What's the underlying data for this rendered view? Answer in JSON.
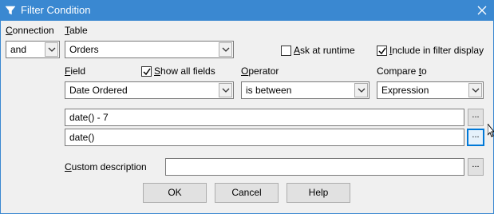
{
  "window": {
    "title": "Filter Condition",
    "title_icon": "filter-funnel-icon",
    "close_icon": "close-icon"
  },
  "labels": {
    "connection_prefix": "",
    "connection_mnemonic": "C",
    "connection_rest": "onnection",
    "table_mnemonic": "T",
    "table_rest": "able",
    "field_mnemonic": "F",
    "field_rest": "ield",
    "operator_mnemonic": "O",
    "operator_rest": "perator",
    "compare_prefix": "Compare ",
    "compare_mnemonic": "t",
    "compare_rest": "o",
    "custom_prefix": "",
    "custom_mnemonic": "C",
    "custom_rest": "ustom description"
  },
  "connection": {
    "value": "and"
  },
  "table": {
    "value": "Orders"
  },
  "ask_at_runtime": {
    "label_mnemonic": "A",
    "label_rest": "sk at runtime",
    "checked": false
  },
  "include_in_filter_display": {
    "label_mnemonic": "I",
    "label_rest": "nclude in filter display",
    "checked": true
  },
  "show_all_fields": {
    "label_mnemonic": "S",
    "label_rest": "how all fields",
    "checked": true
  },
  "field": {
    "value": "Date Ordered"
  },
  "operator": {
    "value": "is between"
  },
  "compare_to": {
    "value": "Expression"
  },
  "expression1": {
    "value": "date() - 7",
    "button": "..."
  },
  "expression2": {
    "value": "date()",
    "button": "..."
  },
  "custom_description": {
    "value": "",
    "button": "..."
  },
  "buttons": {
    "ok": "OK",
    "cancel": "Cancel",
    "help": "Help"
  }
}
